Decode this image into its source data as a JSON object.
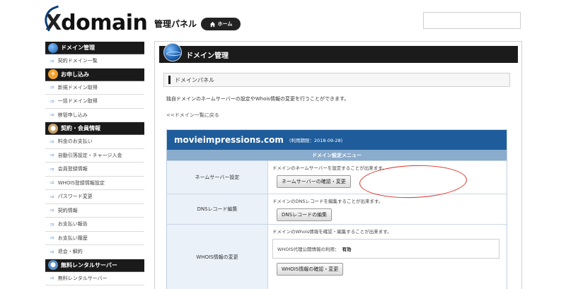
{
  "header": {
    "logo_x": "X",
    "logo_text": "domain",
    "panel_title": "管理パネル",
    "home_label": "ホーム",
    "search": {
      "value": "",
      "placeholder": ""
    }
  },
  "sidebar": {
    "sections": [
      {
        "title": "ドメイン管理",
        "icon": "globe-icon",
        "items": [
          "契約ドメイン一覧"
        ]
      },
      {
        "title": "お申し込み",
        "icon": "plus-icon",
        "items": [
          "新規ドメイン取得",
          "一括ドメイン取得",
          "移管申し込み"
        ]
      },
      {
        "title": "契約・会員情報",
        "icon": "person-icon",
        "items": [
          "料金のお支払い",
          "自動引落設定・チャージ入金",
          "会員登録情報",
          "WHOIS登録情報設定",
          "パスワード変更",
          "契約情報",
          "お支払い報告",
          "お支払い履歴",
          "退会・解約"
        ]
      },
      {
        "title": "無料レンタルサーバー",
        "icon": "server-person-icon",
        "items": [
          "無料レンタルサーバー"
        ]
      }
    ]
  },
  "main": {
    "title": "ドメイン管理",
    "panel_label": "ドメインパネル",
    "intro": "独自ドメインのネームサーバーの設定やWhois情報の変更を行うことができます。",
    "back_link": "<<ドメイン一覧に戻る",
    "domain": {
      "name": "movieimpressions.com",
      "expiry": "(利用期限：2018-09-28)",
      "menu_title": "ドメイン設定メニュー",
      "rows": [
        {
          "label": "ネームサーバー設定",
          "desc": "ドメインのネームサーバーを設定することが出来ます。",
          "button": "ネームサーバーの確認・変更"
        },
        {
          "label": "DNSレコード編集",
          "desc": "ドメインのDNSレコードを編集することが出来ます。",
          "button": "DNSレコードの編集"
        },
        {
          "label": "WHOIS情報の変更",
          "desc": "ドメインのWhois情報を確認・編集することが出来ます。",
          "info_label": "WHOIS代理公開情報の利用：",
          "info_value": "有効",
          "button": "WHOIS情報の確認・変更"
        }
      ]
    }
  },
  "colors": {
    "domain_bar": "#1f5c9b",
    "menu_title_bar": "#8aaccd",
    "highlight_circle": "#d9342b",
    "header_black": "#1b1b1b"
  }
}
